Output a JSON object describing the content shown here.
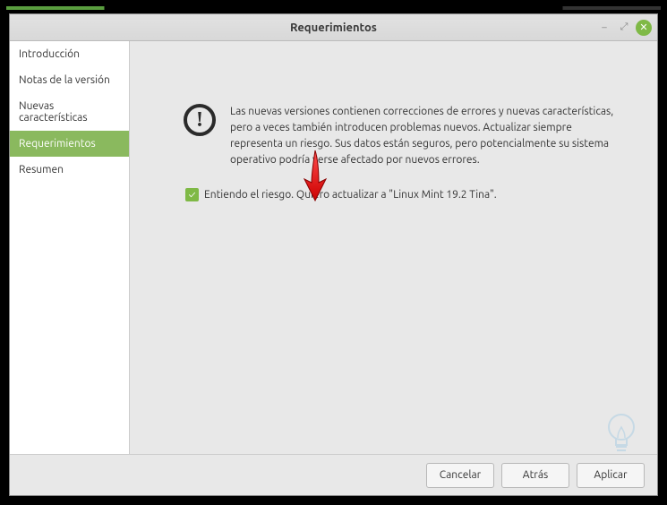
{
  "window": {
    "title": "Requerimientos"
  },
  "sidebar": {
    "items": [
      {
        "label": "Introducción"
      },
      {
        "label": "Notas de la versión"
      },
      {
        "label": "Nuevas características"
      },
      {
        "label": "Requerimientos"
      },
      {
        "label": "Resumen"
      }
    ],
    "active_index": 3
  },
  "content": {
    "info_text": "Las nuevas versiones contienen correcciones de errores y nuevas características, pero a veces también introducen problemas nuevos. Actualizar siempre representa un riesgo. Sus datos están seguros, pero potencialmente su sistema operativo podría verse afectado por nuevos errores.",
    "checkbox_label": "Entiendo el riesgo. Quiero actualizar a \"Linux Mint 19.2 Tina\".",
    "checked": true
  },
  "footer": {
    "cancel": "Cancelar",
    "back": "Atrás",
    "apply": "Aplicar"
  }
}
